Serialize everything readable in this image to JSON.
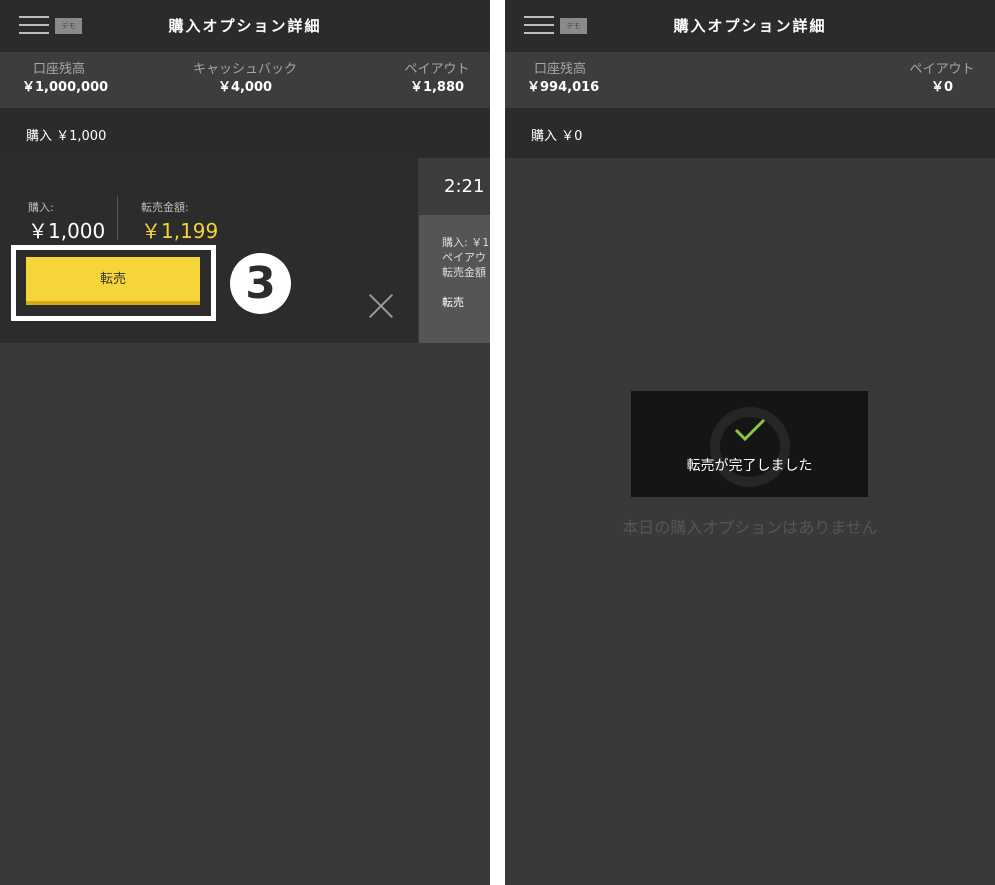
{
  "left": {
    "header": {
      "title": "購入オプション詳細",
      "demo_badge": "デモ"
    },
    "stats": {
      "balance": {
        "label": "口座残高",
        "value": "￥1,000,000"
      },
      "cashback": {
        "label": "キャッシュバック",
        "value": "￥4,000"
      },
      "payout": {
        "label": "ペイアウト",
        "value": "￥1,880"
      }
    },
    "purchase_bar": "購入 ￥1,000",
    "card": {
      "purchase_label": "購入:",
      "purchase_value": "￥1,000",
      "resale_label": "転売金額:",
      "resale_value": "￥1,199",
      "resell_button": "転売",
      "step_marker": "3"
    },
    "side_card": {
      "timer": "2:21",
      "line1": "購入: ￥1",
      "line2": "ペイアウ",
      "line3": "転売金額",
      "action": "転売"
    }
  },
  "right": {
    "header": {
      "title": "購入オプション詳細",
      "demo_badge": "デモ"
    },
    "stats": {
      "balance": {
        "label": "口座残高",
        "value": "￥994,016"
      },
      "payout": {
        "label": "ペイアウト",
        "value": "￥0"
      }
    },
    "purchase_bar": "購入 ￥0",
    "toast": {
      "message": "転売が完了しました"
    },
    "empty_message": "本日の購入オプションはありません"
  },
  "colors": {
    "accent": "#f6d53b",
    "gold_text": "#f3d23d",
    "check": "#8cc63f",
    "background": "#393939"
  }
}
